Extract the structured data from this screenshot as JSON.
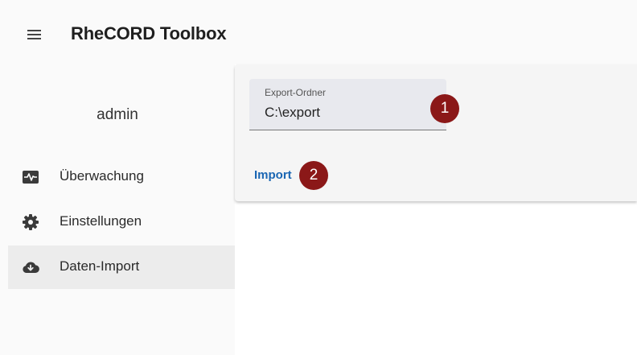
{
  "app": {
    "title": "RheCORD Toolbox"
  },
  "user": {
    "name": "admin"
  },
  "nav": {
    "items": [
      {
        "label": "Überwachung",
        "icon": "monitor-heartbeat-icon"
      },
      {
        "label": "Einstellungen",
        "icon": "gear-icon"
      },
      {
        "label": "Daten-Import",
        "icon": "cloud-download-icon",
        "active": true
      }
    ]
  },
  "export_form": {
    "field_label": "Export-Ordner",
    "field_value": "C:\\export",
    "import_label": "Import"
  },
  "annotations": [
    "1",
    "2"
  ],
  "colors": {
    "accent": "#1a66b3",
    "badge": "#8b1818",
    "active_nav_bg": "#ececec"
  }
}
